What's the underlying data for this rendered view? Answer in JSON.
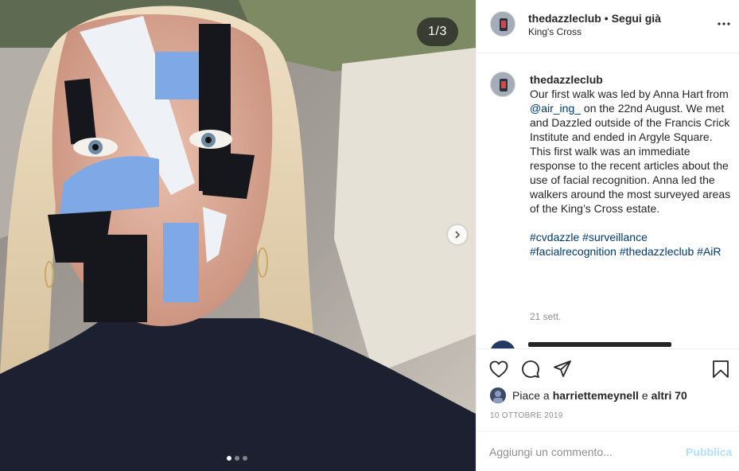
{
  "media": {
    "counter": "1/3",
    "dots_total": 3,
    "dots_active_index": 0,
    "next_icon": "chevron-right-icon"
  },
  "header": {
    "username": "thedazzleclub",
    "separator": "•",
    "follow_label": "Segui già",
    "location": "King's Cross",
    "more_icon": "ellipsis-icon"
  },
  "caption": {
    "username": "thedazzleclub",
    "text_1": "Our first walk was led by Anna Hart from ",
    "mention": "@air_ing_",
    "text_2": " on the 22nd August. We met and Dazzled outside of the Francis Crick Institute and ended in Argyle Square.",
    "text_3": "This first walk was an immediate response to the recent articles about the use of facial recognition. Anna led the walkers around the most surveyed areas of the King’s Cross estate.",
    "hashtags": [
      "#cvdazzle",
      "#surveillance",
      "#facialrecognition",
      "#thedazzleclub",
      "#AiR"
    ],
    "time_ago": "21 sett."
  },
  "actions": {
    "like_icon": "heart-icon",
    "comment_icon": "comment-icon",
    "share_icon": "share-icon",
    "save_icon": "bookmark-icon"
  },
  "likes": {
    "prefix": "Piace a",
    "user": "harriettemeynell",
    "middle": "e",
    "others": "altri 70"
  },
  "date": "10 OTTOBRE 2019",
  "comment_box": {
    "placeholder": "Aggiungi un commento...",
    "publish_label": "Pubblica"
  },
  "colors": {
    "link": "#00376b",
    "publish_disabled": "#b2dffc",
    "muted": "#8e8e8e",
    "text": "#262626",
    "paint_blue": "#7ea9e6",
    "paint_black": "#15171c",
    "paint_white": "#eef1f5"
  }
}
